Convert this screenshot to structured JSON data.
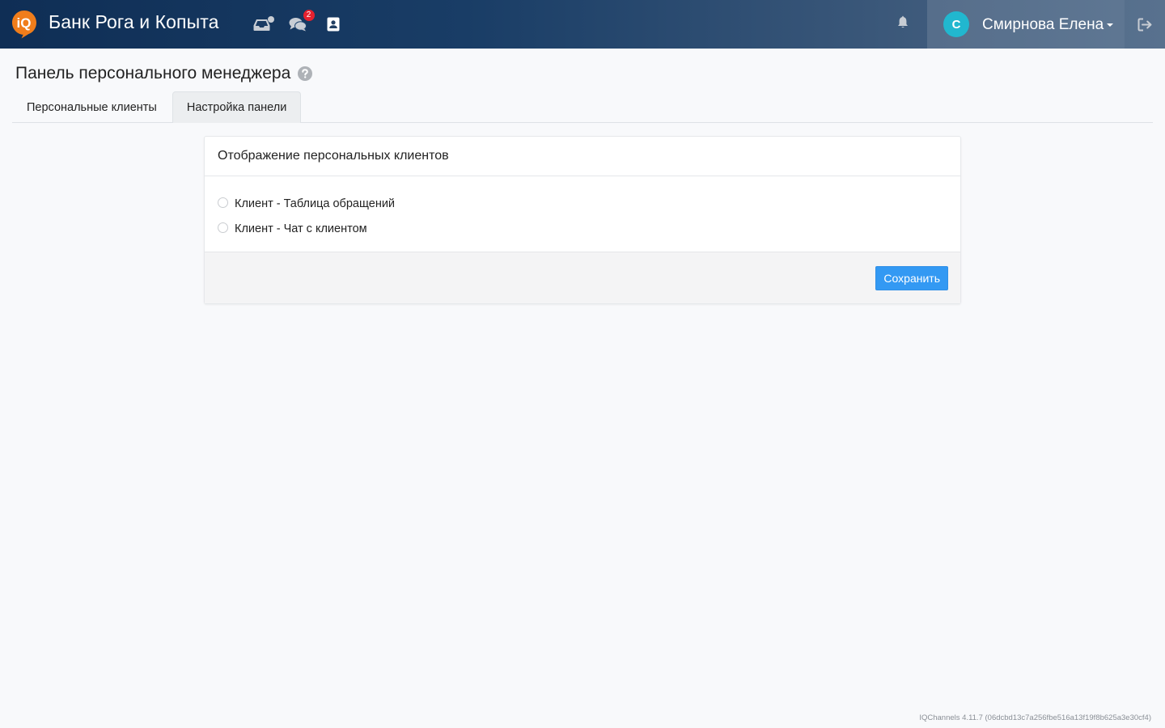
{
  "app": {
    "brand_title": "Банк Рога и Копыта",
    "logo_text": "iQ"
  },
  "navbar": {
    "icons": [
      "inbox-icon",
      "chats-icon",
      "contacts-icon"
    ],
    "chats_count": "2",
    "user_initial": "С",
    "user_name": "Смирнова Елена"
  },
  "page": {
    "title": "Панель персонального менеджера"
  },
  "tabs": [
    {
      "label": "Персональные клиенты",
      "active": false
    },
    {
      "label": "Настройка панели",
      "active": true
    }
  ],
  "card": {
    "title": "Отображение персональных клиентов",
    "options": [
      {
        "label": "Клиент - Таблица обращений",
        "checked": false
      },
      {
        "label": "Клиент - Чат с клиентом",
        "checked": false
      }
    ],
    "save_label": "Сохранить"
  },
  "footer": {
    "version": "IQChannels 4.11.7 (06dcbd13c7a256fbe516a13f19f8b625a3e30cf4)"
  },
  "colors": {
    "navbar_start": "#0f2e55",
    "navbar_end": "#4a6585",
    "logo_orange": "#f07d1b",
    "avatar": "#21b7cf",
    "badge": "#e5212f",
    "primary_button": "#3399f3"
  }
}
